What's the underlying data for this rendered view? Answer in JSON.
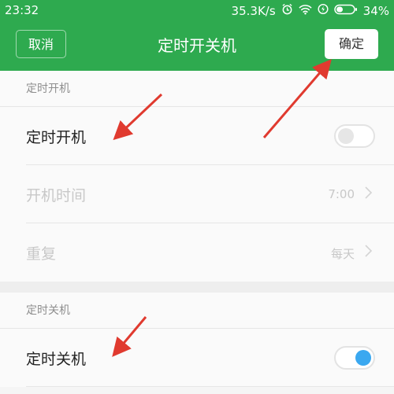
{
  "status": {
    "time": "23:32",
    "net_speed": "35.3K/s",
    "battery": "34%"
  },
  "header": {
    "cancel_label": "取消",
    "title": "定时开关机",
    "confirm_label": "确定"
  },
  "power_on": {
    "section_label": "定时开机",
    "toggle_label": "定时开机",
    "toggle_on": false,
    "time_label": "开机时间",
    "time_value": "7:00",
    "repeat_label": "重复",
    "repeat_value": "每天"
  },
  "power_off": {
    "section_label": "定时关机",
    "toggle_label": "定时关机",
    "toggle_on": true
  },
  "colors": {
    "brand_green": "#2eaa4f",
    "toggle_on": "#3aa8f0",
    "annotation_red": "#e03a2f"
  }
}
